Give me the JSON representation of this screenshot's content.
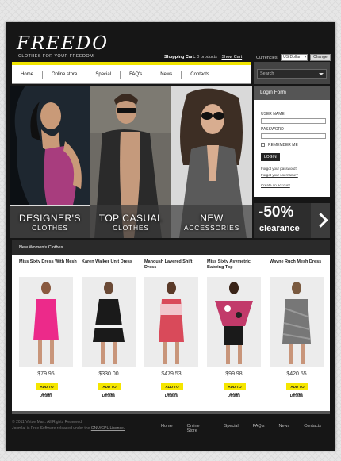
{
  "header": {
    "logo": "FREEDO",
    "tagline": "CLOTHES FOR YOUR FREEDOM!",
    "cart_label": "Shopping Cart:",
    "cart_count": "0 products",
    "show_cart": "Show Cart",
    "currencies_label": "Currencies:",
    "currency_selected": "US Dollar",
    "change_button": "Change"
  },
  "nav": [
    "Home",
    "Online store",
    "Special",
    "FAQ's",
    "News",
    "Contacts"
  ],
  "search": {
    "placeholder": "Search"
  },
  "login": {
    "title": "Login Form",
    "username_label": "USER NAME",
    "password_label": "PASSWORD",
    "remember_label": "REMEMBER ME",
    "login_button": "LOGIN",
    "forgot_password": "Forgot your password?",
    "forgot_username": "Forgot your username?",
    "create_account": "Create an account"
  },
  "banners": [
    {
      "line1": "DESIGNER'S",
      "line2": "CLOTHES"
    },
    {
      "line1": "TOP CASUAL",
      "line2": "CLOTHES"
    },
    {
      "line1": "NEW",
      "line2": "ACCESSORIES"
    }
  ],
  "promo": {
    "percent": "-50%",
    "text": "clearance"
  },
  "products": {
    "heading": "New Women's Clothes",
    "add_label": "ADD TO CART",
    "details_label": "Details",
    "items": [
      {
        "name": "Miss Sixty Dress With Mesh",
        "price": "$79.95",
        "color": "#ec2a8a"
      },
      {
        "name": "Karen Walker Unit Dress",
        "price": "$330.00",
        "color": "#1a1a1a"
      },
      {
        "name": "Manoush Layered Shift Dress",
        "price": "$479.53",
        "color": "#d94a5a"
      },
      {
        "name": "Miss Sixty Asymetric Batwing Top",
        "price": "$99.98",
        "color": "#c23a6a"
      },
      {
        "name": "Wayne Ruch Mesh Dress",
        "price": "$420.55",
        "color": "#777777"
      }
    ]
  },
  "footer": {
    "copyright": "© 2011 Virtue Mart. All Rights Reserved.",
    "license_prefix": "Joomla! is Free Software released under the",
    "license_link": "GNU/GPL License.",
    "nav": [
      "Home",
      "Online Store",
      "Special",
      "FAQ's",
      "News",
      "Contacts"
    ]
  }
}
